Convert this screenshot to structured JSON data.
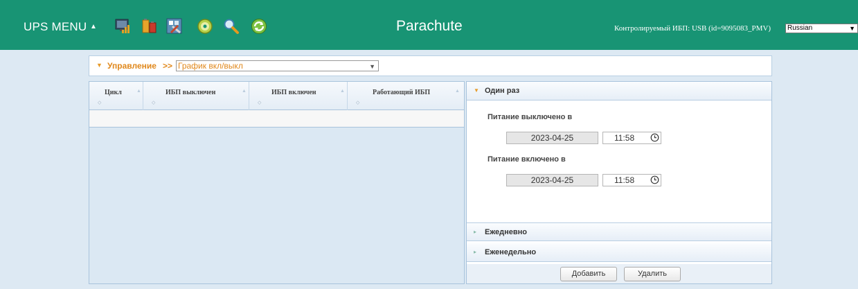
{
  "header": {
    "menu_title": "UPS MENU",
    "menu_arrow": "▲",
    "brand": "Parachute",
    "monitored_label": "Контролируемый ИБП: USB (id=9095083_PMV)",
    "language": "Russian",
    "background_color": "#189474",
    "toolbar_icons": [
      "monitor-chart-icon",
      "battery-stack-icon",
      "settings-tools-icon",
      "disc-icon",
      "search-icon",
      "refresh-icon"
    ]
  },
  "breadcrumb": {
    "section": "Управление",
    "separator": ">>",
    "page_select": "График вкл/выкл",
    "accent_color": "#e0881c"
  },
  "table": {
    "columns": [
      "Цикл",
      "ИБП выключен",
      "ИБП включен",
      "Работающий ИБП"
    ]
  },
  "schedule": {
    "once": {
      "title": "Один раз",
      "power_off_label": "Питание выключено в",
      "power_off_date": "2023-04-25",
      "power_off_time": "11:58",
      "power_on_label": "Питание включено в",
      "power_on_date": "2023-04-25",
      "power_on_time": "11:58"
    },
    "daily_title": "Ежедневно",
    "weekly_title": "Еженедельно"
  },
  "actions": {
    "add_label": "Добавить",
    "delete_label": "Удалить"
  }
}
